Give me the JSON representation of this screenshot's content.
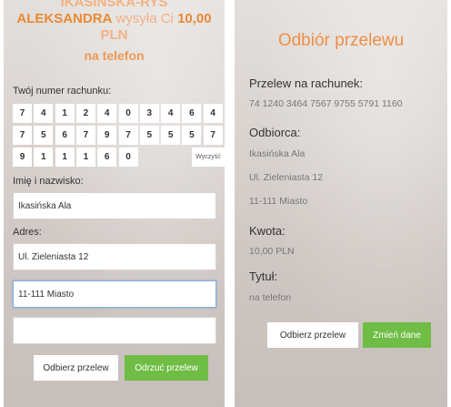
{
  "left": {
    "headline_line1": "IKASIŃSKA-RYS",
    "headline_name": "ALEKSANDRA",
    "headline_text": " wysyła Ci ",
    "headline_amount": "10,00",
    "headline_line3": "PLN",
    "headline_line4": "na telefon",
    "account_label": "Twój numer rachunku:",
    "digits_row1": [
      "7",
      "4",
      "1",
      "2",
      "4",
      "0",
      "3",
      "4",
      "6",
      "4"
    ],
    "digits_row2": [
      "7",
      "5",
      "6",
      "7",
      "9",
      "7",
      "5",
      "5",
      "5",
      "7"
    ],
    "digits_row3": [
      "9",
      "1",
      "1",
      "1",
      "6",
      "0"
    ],
    "clear_label": "Wyczyść",
    "name_label": "Imię i nazwisko:",
    "name_value": "Ikasińska Ala",
    "address_label": "Adres:",
    "street_value": "Ul. Zieleniasta 12",
    "city_value": "11-111 Miasto",
    "extra_value": "",
    "receive_button": "Odbierz przelew",
    "reject_button": "Odrzuć przelew"
  },
  "right": {
    "title": "Odbiór przelewu",
    "account_label": "Przelew na rachunek:",
    "account_value": "74 1240 3464 7567 9755 5791 1160",
    "recipient_label": "Odbiorca:",
    "recipient_name": "Ikasińska Ala",
    "recipient_street": "Ul. Zieleniasta 12",
    "recipient_city": "11-111 Miasto",
    "amount_label": "Kwota:",
    "amount_value": "10,00 PLN",
    "subject_label": "Tytuł:",
    "subject_value": "na telefon",
    "receive_button": "Odbierz przelew",
    "change_button": "Zmień dane"
  },
  "colors": {
    "accent_orange": "#ee8f46",
    "accent_green": "#6fbd45"
  }
}
